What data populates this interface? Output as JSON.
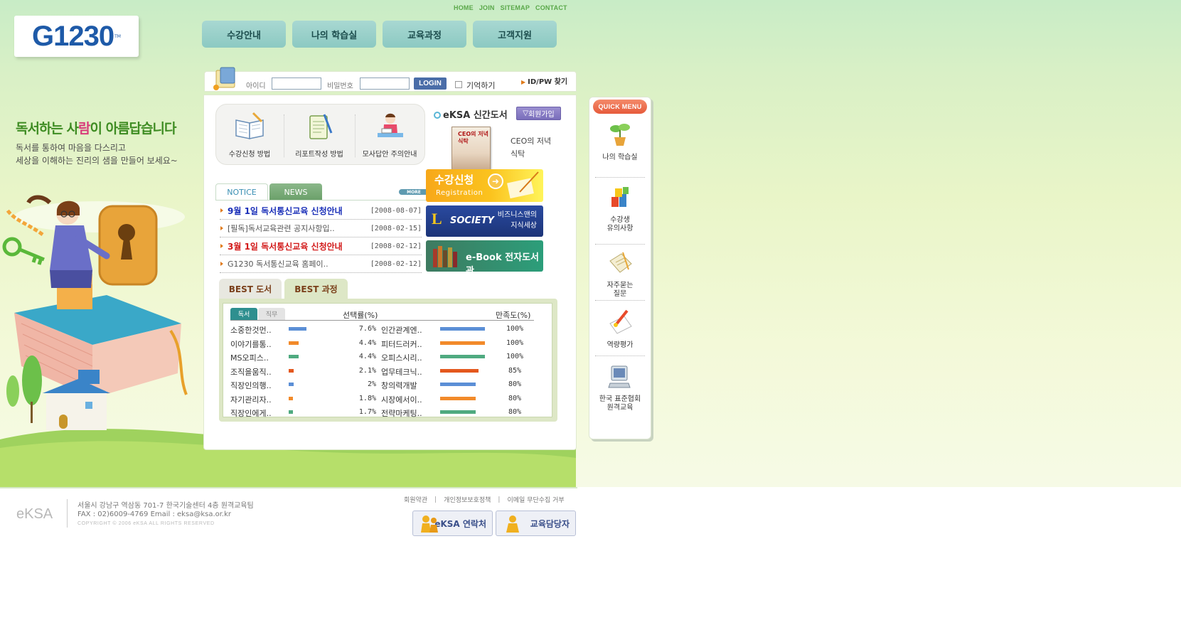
{
  "top_links": [
    "HOME",
    "JOIN",
    "SITEMAP",
    "CONTACT"
  ],
  "logo": {
    "text": "G1230",
    "tm": "TM"
  },
  "nav": [
    "수강안내",
    "나의 학습실",
    "교육과정",
    "고객지원"
  ],
  "slogan": {
    "title_a": "독서하는 사",
    "title_b": "람",
    "title_c": "이 아름답습니다",
    "line1": "독서를 통하여 마음을 다스리고",
    "line2": "세상을 이해하는 진리의 샘을 만들어 보세요~"
  },
  "login": {
    "id_label": "아이디",
    "pw_label": "비밀번호",
    "button": "LOGIN",
    "remember": "기억하기",
    "find": "ID/PW 찾기"
  },
  "guide": [
    "수강신청 방법",
    "리포트작성 방법",
    "모사답안 주의안내"
  ],
  "new_book": {
    "title": "eKSA 신간도서",
    "join_button": "회원가입",
    "cover_text": "CEO의 저녁식탁",
    "name": "CEO의 저녁식탁"
  },
  "notice": {
    "tab_notice": "NOTICE",
    "tab_news": "NEWS",
    "more": "MORE",
    "items": [
      {
        "title": "9월 1일 독서통신교육 신청안내",
        "date": "[2008-08-07]",
        "style": "blue"
      },
      {
        "title": "[필독]독서교육관련 공지사항입..",
        "date": "[2008-02-15]",
        "style": "normal"
      },
      {
        "title": "3월 1일 독서통신교육 신청안내",
        "date": "[2008-02-12]",
        "style": "red"
      },
      {
        "title": "G1230 독서통신교육 홈페이..",
        "date": "[2008-02-12]",
        "style": "normal"
      }
    ]
  },
  "banners": {
    "registration_title": "수강신청",
    "registration_sub": "Registration",
    "society_logo": "L",
    "society_text": "SOCIETY",
    "society_sub1": "비즈니스맨의",
    "society_sub2": "지식세상",
    "ebook": "e-Book 전자도서관"
  },
  "best": {
    "tab_books": "BEST 도서",
    "tab_courses": "BEST 과정",
    "sub_tab_reading": "독서",
    "sub_tab_job": "직무",
    "header_rate": "선택률(%)",
    "header_satisfaction": "만족도(%)",
    "rows": [
      {
        "book": "소중한것먼..",
        "rate": "7.6%",
        "rate_value": 7.6,
        "course": "인간관계엔..",
        "sat": "100%",
        "sat_value": 100
      },
      {
        "book": "이야기를통..",
        "rate": "4.4%",
        "rate_value": 4.4,
        "course": "피터드러커..",
        "sat": "100%",
        "sat_value": 100
      },
      {
        "book": "MS오피스..",
        "rate": "4.4%",
        "rate_value": 4.4,
        "course": "오피스시리..",
        "sat": "100%",
        "sat_value": 100
      },
      {
        "book": "조직을움직..",
        "rate": "2.1%",
        "rate_value": 2.1,
        "course": "업무테크닉..",
        "sat": "85%",
        "sat_value": 85
      },
      {
        "book": "직장인의행..",
        "rate": "2%",
        "rate_value": 2,
        "course": "창의력개발",
        "sat": "80%",
        "sat_value": 80
      },
      {
        "book": "자기관리자..",
        "rate": "1.8%",
        "rate_value": 1.8,
        "course": "시장에서이..",
        "sat": "80%",
        "sat_value": 80
      },
      {
        "book": "직장인에게..",
        "rate": "1.7%",
        "rate_value": 1.7,
        "course": "전략마케팅..",
        "sat": "80%",
        "sat_value": 80
      }
    ],
    "bar_colors": [
      "#5b8fd6",
      "#f28a2a",
      "#4faa80",
      "#e4581e",
      "#5b8fd6",
      "#f28a2a",
      "#4faa80"
    ]
  },
  "quick_menu": {
    "title": "QUICK MENU",
    "items": [
      {
        "label1": "나의 학습실",
        "label2": ""
      },
      {
        "label1": "수강생",
        "label2": "유의사항"
      },
      {
        "label1": "자주묻는",
        "label2": "질문"
      },
      {
        "label1": "역량평가",
        "label2": ""
      },
      {
        "label1": "한국 표준협회",
        "label2": "원격교육"
      }
    ]
  },
  "footer": {
    "logo": "eKSA",
    "address": "서울시 강남구 역삼동 701-7 한국기술센터 4층 원격교육팀",
    "fax": "FAX : 02)6009-4769  Email : eksa@ksa.or.kr",
    "copyright": "COPYRIGHT © 2006 eKSA ALL RIGHTS RESERVED",
    "links": [
      "회원약관",
      "개인정보보호정책",
      "이메일 무단수집 거부"
    ],
    "btn_contact": "eKSA 연락처",
    "btn_manager": "교육담당자"
  }
}
